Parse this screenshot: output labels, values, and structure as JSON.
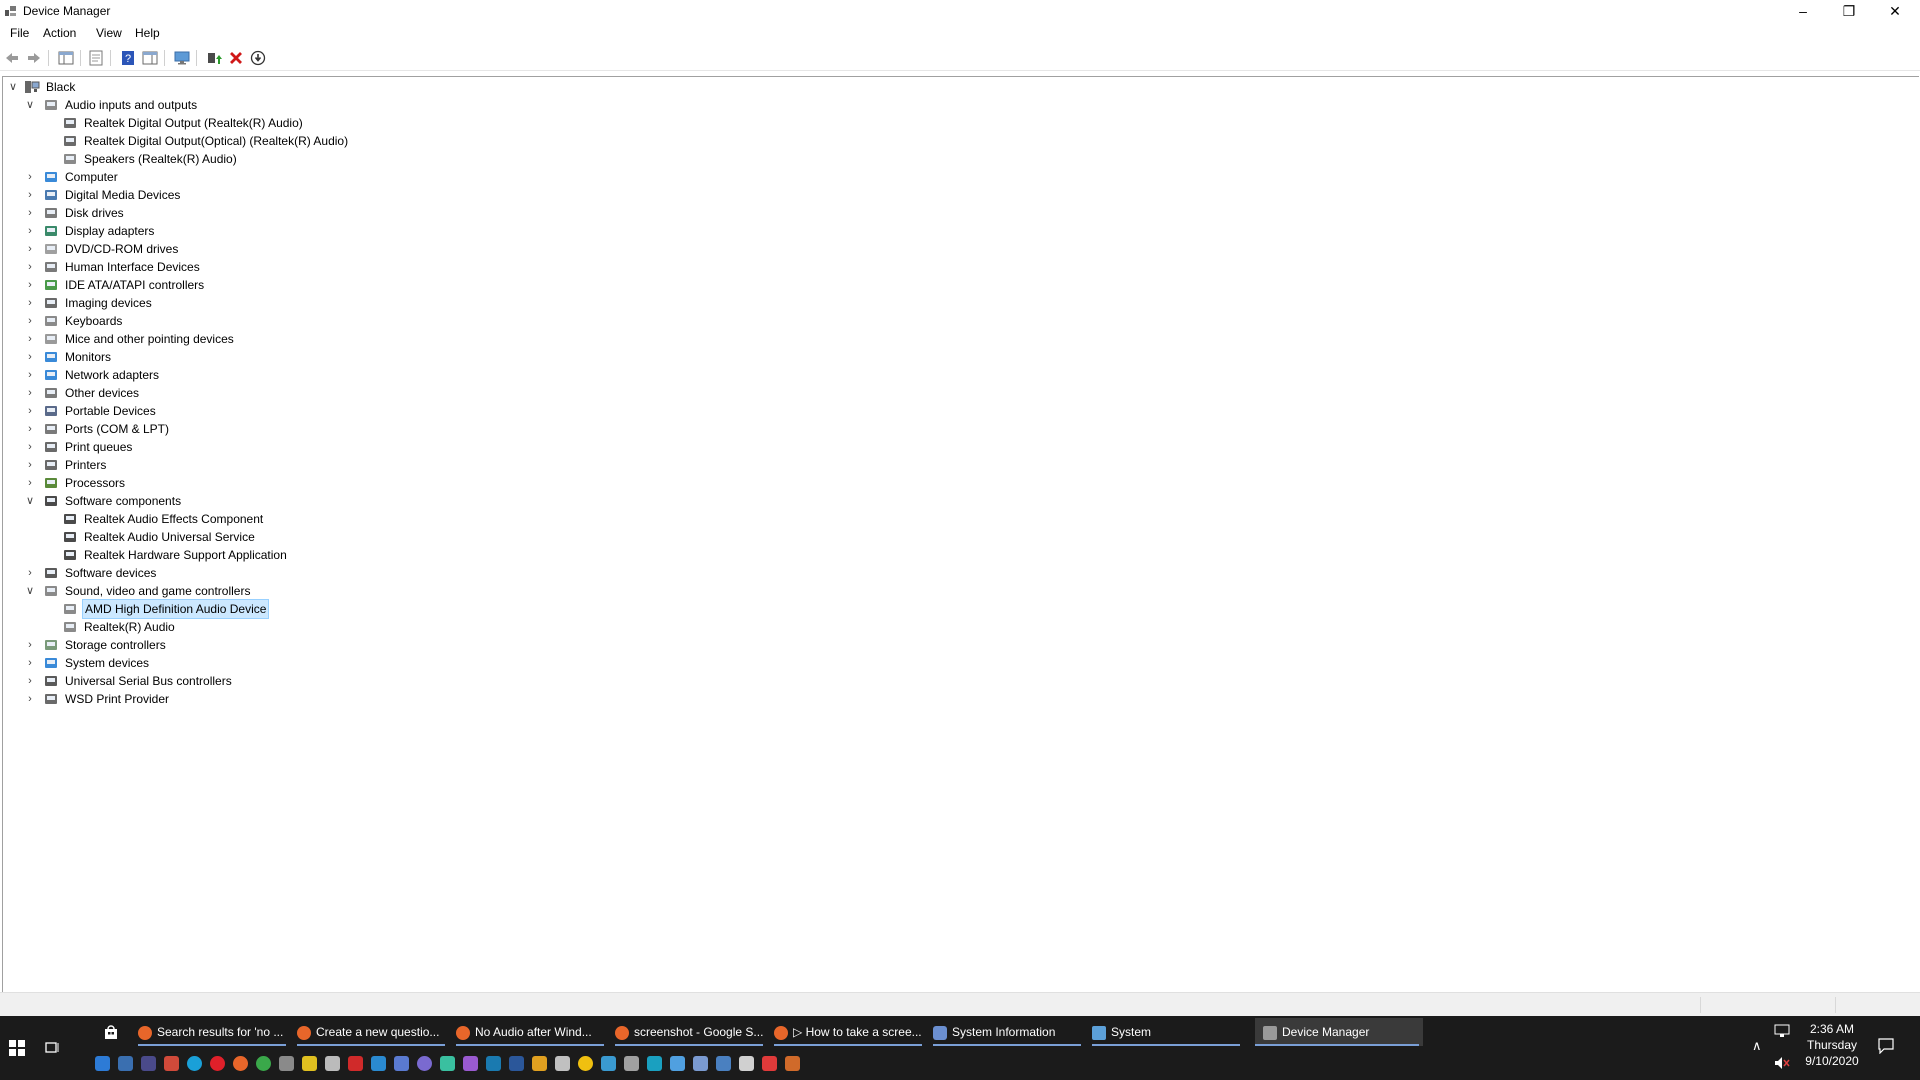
{
  "window": {
    "title": "Device Manager"
  },
  "menu": [
    "File",
    "Action",
    "View",
    "Help"
  ],
  "tree": {
    "root": "Black",
    "nodes": [
      {
        "label": "Audio inputs and outputs",
        "level": 1,
        "state": "expanded",
        "icon": "speaker-icon"
      },
      {
        "label": "Realtek Digital Output (Realtek(R) Audio)",
        "level": 2,
        "state": "leaf",
        "icon": "audio-output-icon"
      },
      {
        "label": "Realtek Digital Output(Optical) (Realtek(R) Audio)",
        "level": 2,
        "state": "leaf",
        "icon": "audio-output-icon"
      },
      {
        "label": "Speakers (Realtek(R) Audio)",
        "level": 2,
        "state": "leaf",
        "icon": "speaker-icon"
      },
      {
        "label": "Computer",
        "level": 1,
        "state": "collapsed",
        "icon": "computer-icon"
      },
      {
        "label": "Digital Media Devices",
        "level": 1,
        "state": "collapsed",
        "icon": "media-device-icon"
      },
      {
        "label": "Disk drives",
        "level": 1,
        "state": "collapsed",
        "icon": "disk-drive-icon"
      },
      {
        "label": "Display adapters",
        "level": 1,
        "state": "collapsed",
        "icon": "display-adapter-icon"
      },
      {
        "label": "DVD/CD-ROM drives",
        "level": 1,
        "state": "collapsed",
        "icon": "dvd-drive-icon"
      },
      {
        "label": "Human Interface Devices",
        "level": 1,
        "state": "collapsed",
        "icon": "hid-icon"
      },
      {
        "label": "IDE ATA/ATAPI controllers",
        "level": 1,
        "state": "collapsed",
        "icon": "ide-controller-icon"
      },
      {
        "label": "Imaging devices",
        "level": 1,
        "state": "collapsed",
        "icon": "camera-icon"
      },
      {
        "label": "Keyboards",
        "level": 1,
        "state": "collapsed",
        "icon": "keyboard-icon"
      },
      {
        "label": "Mice and other pointing devices",
        "level": 1,
        "state": "collapsed",
        "icon": "mouse-icon"
      },
      {
        "label": "Monitors",
        "level": 1,
        "state": "collapsed",
        "icon": "monitor-icon"
      },
      {
        "label": "Network adapters",
        "level": 1,
        "state": "collapsed",
        "icon": "network-adapter-icon"
      },
      {
        "label": "Other devices",
        "level": 1,
        "state": "collapsed",
        "icon": "unknown-device-icon"
      },
      {
        "label": "Portable Devices",
        "level": 1,
        "state": "collapsed",
        "icon": "portable-device-icon"
      },
      {
        "label": "Ports (COM & LPT)",
        "level": 1,
        "state": "collapsed",
        "icon": "port-icon"
      },
      {
        "label": "Print queues",
        "level": 1,
        "state": "collapsed",
        "icon": "printer-icon"
      },
      {
        "label": "Printers",
        "level": 1,
        "state": "collapsed",
        "icon": "printer-icon"
      },
      {
        "label": "Processors",
        "level": 1,
        "state": "collapsed",
        "icon": "processor-icon"
      },
      {
        "label": "Software components",
        "level": 1,
        "state": "expanded",
        "icon": "software-component-icon"
      },
      {
        "label": "Realtek Audio Effects Component",
        "level": 2,
        "state": "leaf",
        "icon": "software-component-icon"
      },
      {
        "label": "Realtek Audio Universal Service",
        "level": 2,
        "state": "leaf",
        "icon": "software-component-icon"
      },
      {
        "label": "Realtek Hardware Support Application",
        "level": 2,
        "state": "leaf",
        "icon": "software-component-icon"
      },
      {
        "label": "Software devices",
        "level": 1,
        "state": "collapsed",
        "icon": "software-device-icon"
      },
      {
        "label": "Sound, video and game controllers",
        "level": 1,
        "state": "expanded",
        "icon": "speaker-icon"
      },
      {
        "label": "AMD High Definition Audio Device",
        "level": 2,
        "state": "leaf",
        "icon": "speaker-icon",
        "selected": true
      },
      {
        "label": "Realtek(R) Audio",
        "level": 2,
        "state": "leaf",
        "icon": "speaker-icon"
      },
      {
        "label": "Storage controllers",
        "level": 1,
        "state": "collapsed",
        "icon": "storage-controller-icon"
      },
      {
        "label": "System devices",
        "level": 1,
        "state": "collapsed",
        "icon": "system-device-icon"
      },
      {
        "label": "Universal Serial Bus controllers",
        "level": 1,
        "state": "collapsed",
        "icon": "usb-icon"
      },
      {
        "label": "WSD Print Provider",
        "level": 1,
        "state": "collapsed",
        "icon": "printer-icon"
      }
    ]
  },
  "taskbar": {
    "tasks": [
      {
        "label": "Search results for 'no ...",
        "icon": "firefox-icon"
      },
      {
        "label": "Create a new questio...",
        "icon": "firefox-icon"
      },
      {
        "label": "No Audio after Wind...",
        "icon": "firefox-icon"
      },
      {
        "label": "screenshot - Google S...",
        "icon": "firefox-icon"
      },
      {
        "label": "▷ How to take a scree...",
        "icon": "firefox-icon"
      },
      {
        "label": "System Information",
        "icon": "system-information-icon"
      },
      {
        "label": "System",
        "icon": "system-icon"
      },
      {
        "label": "Device Manager",
        "icon": "device-manager-icon",
        "active": true
      }
    ],
    "clock": {
      "time": "2:36 AM",
      "day": "Thursday",
      "date": "9/10/2020"
    }
  },
  "colors": {
    "selection": "#cce8ff",
    "taskbar": "#1b1b1b",
    "accent": "#7a9fd6"
  }
}
